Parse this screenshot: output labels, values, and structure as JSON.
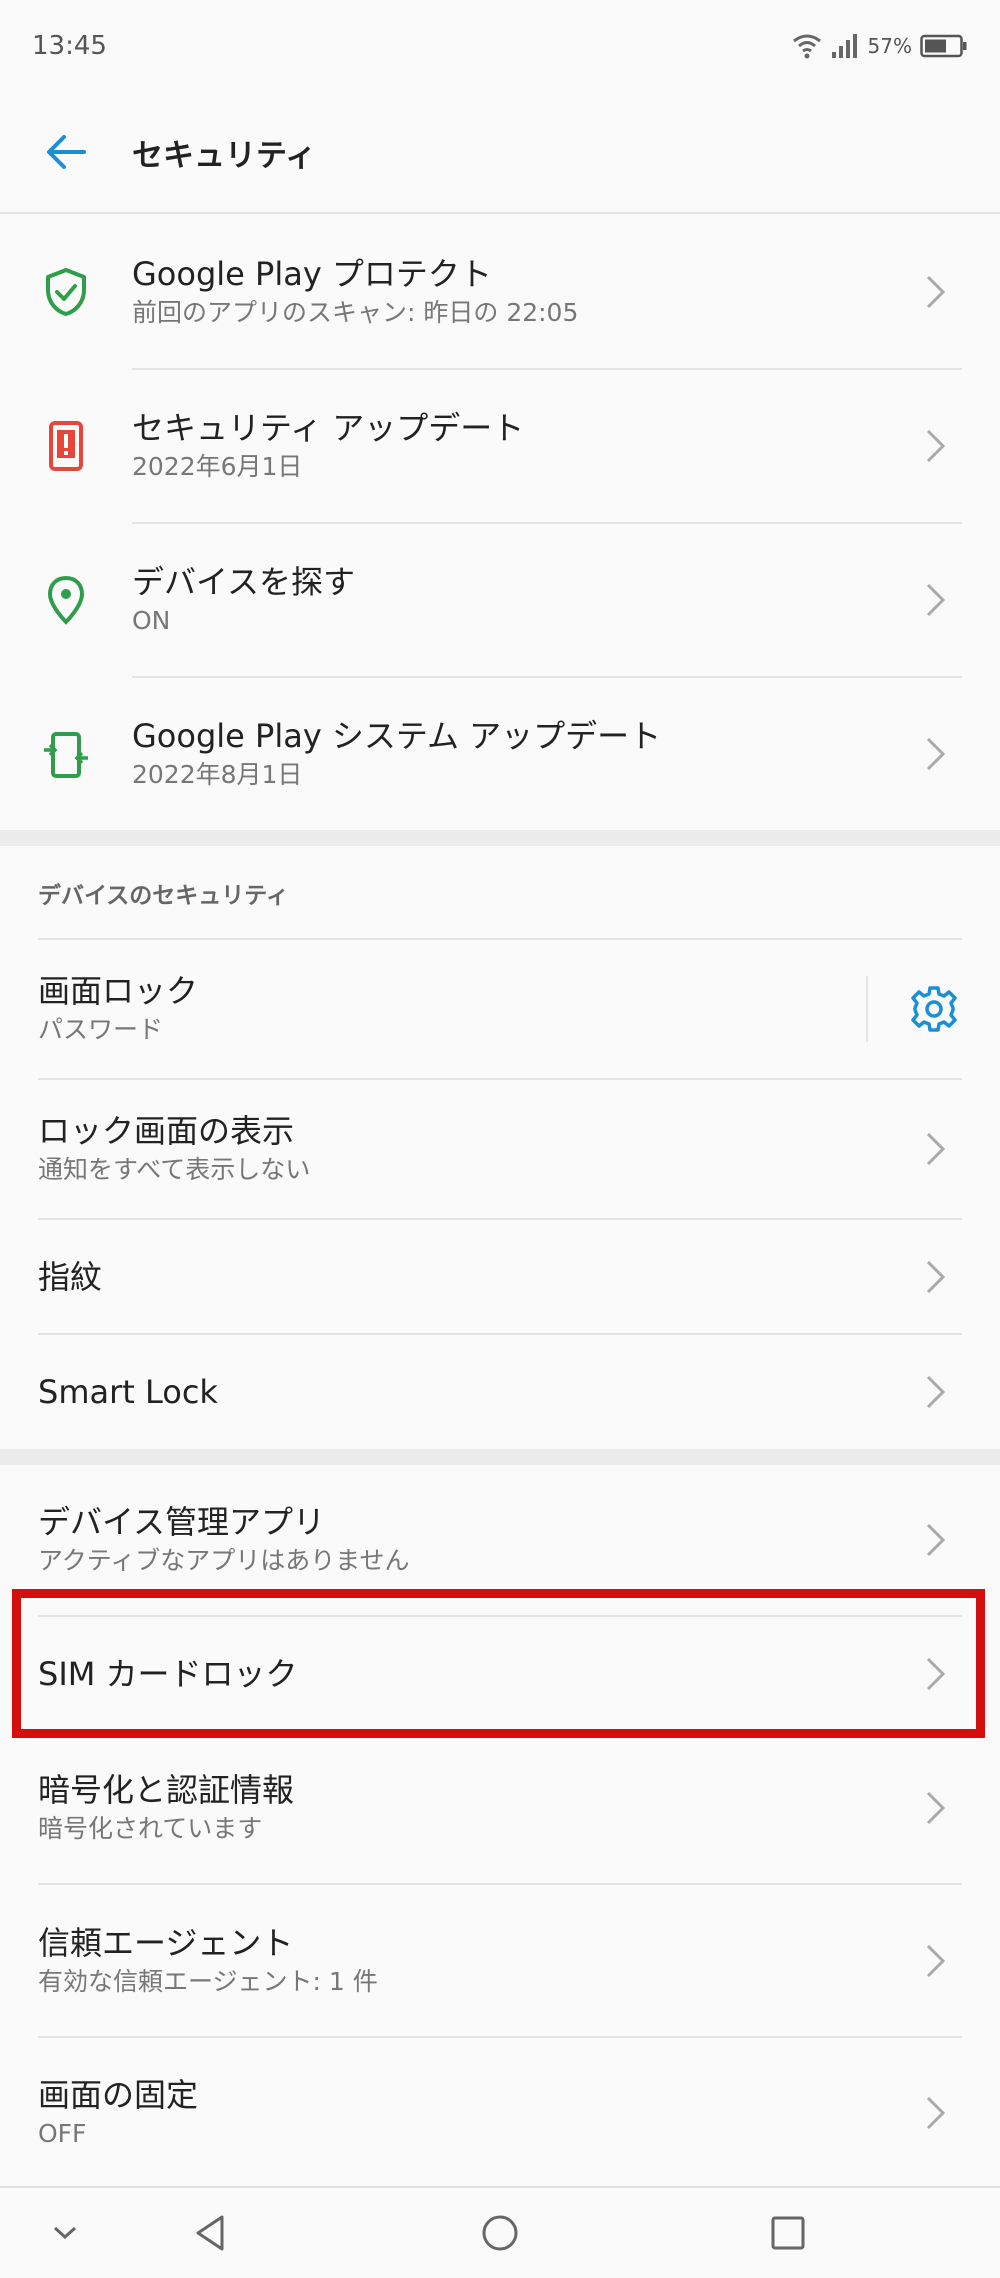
{
  "status_bar": {
    "time": "13:45",
    "battery_percent": "57%",
    "icons": [
      "wifi-icon",
      "cell-signal-icon",
      "battery-icon"
    ]
  },
  "app_bar": {
    "title": "セキュリティ",
    "back_icon": "arrow-left-icon"
  },
  "top_items": [
    {
      "title": "Google Play プロテクト",
      "summary": "前回のアプリのスキャン: 昨日の 22:05",
      "icon": "shield-check-icon",
      "icon_color": "#2e9e4a"
    },
    {
      "title": "セキュリティ アップデート",
      "summary": "2022年6月1日",
      "icon": "phone-alert-icon",
      "icon_color": "#e5483b"
    },
    {
      "title": "デバイスを探す",
      "summary": "ON",
      "icon": "location-pin-icon",
      "icon_color": "#2e9e4a"
    },
    {
      "title": "Google Play システム アップデート",
      "summary": "2022年8月1日",
      "icon": "phone-update-icon",
      "icon_color": "#2e9e4a"
    }
  ],
  "device_security": {
    "header": "デバイスのセキュリティ",
    "screen_lock": {
      "title": "画面ロック",
      "summary": "パスワード",
      "settings_icon": "gear-icon",
      "accent_color": "#1a8fd6"
    },
    "lock_screen_display": {
      "title": "ロック画面の表示",
      "summary": "通知をすべて表示しない"
    },
    "fingerprint": {
      "title": "指紋"
    },
    "smart_lock": {
      "title": "Smart Lock"
    }
  },
  "advanced": {
    "device_admin": {
      "title": "デバイス管理アプリ",
      "summary": "アクティブなアプリはありません"
    },
    "sim_lock": {
      "title": "SIM カードロック"
    },
    "encryption": {
      "title": "暗号化と認証情報",
      "summary": "暗号化されています"
    },
    "trust_agents": {
      "title": "信頼エージェント",
      "summary": "有効な信頼エージェント: 1 件"
    },
    "screen_pinning": {
      "title": "画面の固定",
      "summary": "OFF"
    }
  },
  "highlight_color": "#d40d0d",
  "nav_bar": {
    "icons": [
      "chevron-down-icon",
      "nav-back-icon",
      "nav-home-icon",
      "nav-recents-icon"
    ]
  }
}
